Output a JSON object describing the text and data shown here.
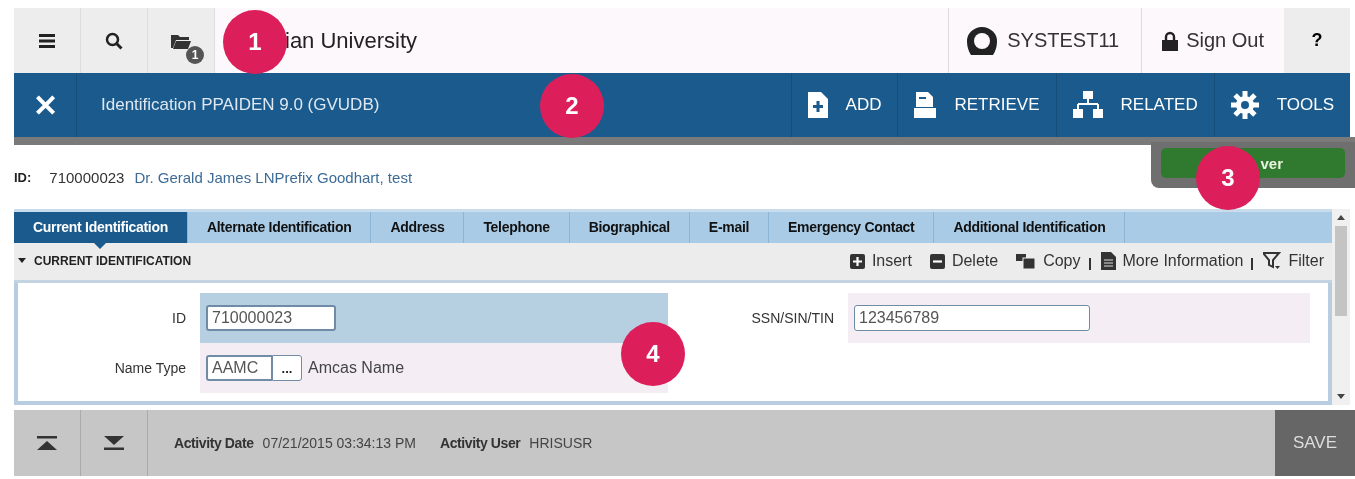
{
  "header": {
    "folder_badge": "1",
    "institution": "ian University",
    "user": "SYSTEST11",
    "sign_out": "Sign Out",
    "help": "?"
  },
  "form_bar": {
    "close": "✕",
    "title": "Identification PPAIDEN 9.0 (GVUDB)",
    "actions": [
      {
        "kind": "add",
        "label": "ADD"
      },
      {
        "kind": "retrieve",
        "label": "RETRIEVE"
      },
      {
        "kind": "related",
        "label": "RELATED"
      },
      {
        "kind": "tools",
        "label": "TOOLS"
      }
    ]
  },
  "key_block": {
    "label": "ID:",
    "id": "710000023",
    "name": "Dr. Gerald James LNPrefix Goodhart, test",
    "go_button": "ver"
  },
  "tabs": [
    {
      "label": "Current Identification",
      "selected": true
    },
    {
      "label": "Alternate Identification",
      "selected": false
    },
    {
      "label": "Address",
      "selected": false
    },
    {
      "label": "Telephone",
      "selected": false
    },
    {
      "label": "Biographical",
      "selected": false
    },
    {
      "label": "E-mail",
      "selected": false
    },
    {
      "label": "Emergency Contact",
      "selected": false
    },
    {
      "label": "Additional Identification",
      "selected": false
    }
  ],
  "section": {
    "title": "CURRENT IDENTIFICATION",
    "expanded": true,
    "tools": [
      {
        "kind": "insert",
        "label": "Insert"
      },
      {
        "kind": "delete",
        "label": "Delete"
      },
      {
        "kind": "copy",
        "label": "Copy"
      },
      {
        "kind": "info",
        "label": "More Information"
      },
      {
        "kind": "filter",
        "label": "Filter"
      }
    ]
  },
  "fields": {
    "id_label": "ID",
    "id_value": "710000023",
    "name_type_label": "Name Type",
    "name_type_value": "AAMC",
    "lookup": "...",
    "name_type_desc": "Amcas Name",
    "ssn_label": "SSN/SIN/TIN",
    "ssn_value": "123456789"
  },
  "status_bar": {
    "date_label": "Activity Date",
    "date_value": "07/21/2015 03:34:13 PM",
    "user_label": "Activity User",
    "user_value": "HRISUSR",
    "save": "SAVE"
  },
  "callouts": [
    "1",
    "2",
    "3",
    "4"
  ]
}
